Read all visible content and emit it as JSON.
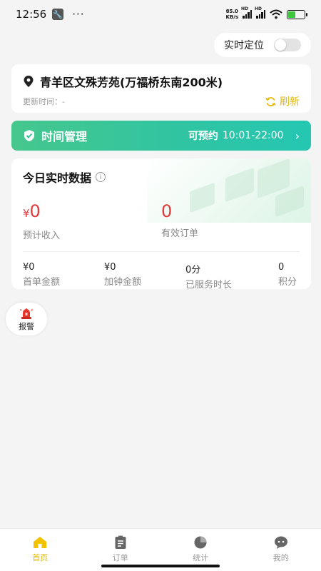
{
  "status_bar": {
    "time": "12:56",
    "more": "···",
    "net_speed_value": "85.0",
    "net_speed_unit": "KB/s",
    "signal_tag": "HD",
    "battery_level": 0.45
  },
  "location_toggle": {
    "label": "实时定位",
    "enabled": false
  },
  "address_card": {
    "address": "青羊区文殊芳苑(万福桥东南200米)",
    "update_time": "更新时间：-",
    "refresh_label": "刷新"
  },
  "time_management": {
    "title": "时间管理",
    "bookable_label": "可预约",
    "bookable_time": "10:01-22:00",
    "chevron": "›"
  },
  "realtime_data": {
    "title": "今日实时数据",
    "info_glyph": "i",
    "expected_income": {
      "currency": "¥",
      "value": "0",
      "label": "预计收入"
    },
    "valid_orders": {
      "value": "0",
      "label": "有效订单"
    },
    "stats": [
      {
        "value": "¥0",
        "label": "首单金额"
      },
      {
        "value": "¥0",
        "label": "加钟金额"
      },
      {
        "value": "0分",
        "label": "已服务时长"
      },
      {
        "value": "0",
        "label": "积分"
      }
    ]
  },
  "alarm_button": {
    "label": "报警"
  },
  "tabbar": {
    "tabs": [
      {
        "label": "首页",
        "icon": "home-icon",
        "active": true
      },
      {
        "label": "订单",
        "icon": "clipboard-icon",
        "active": false
      },
      {
        "label": "统计",
        "icon": "pie-chart-icon",
        "active": false
      },
      {
        "label": "我的",
        "icon": "profile-icon",
        "active": false
      }
    ]
  },
  "colors": {
    "accent": "#e6b800",
    "banner_green": "#2fc4a3",
    "value_red": "#e03a3a"
  }
}
